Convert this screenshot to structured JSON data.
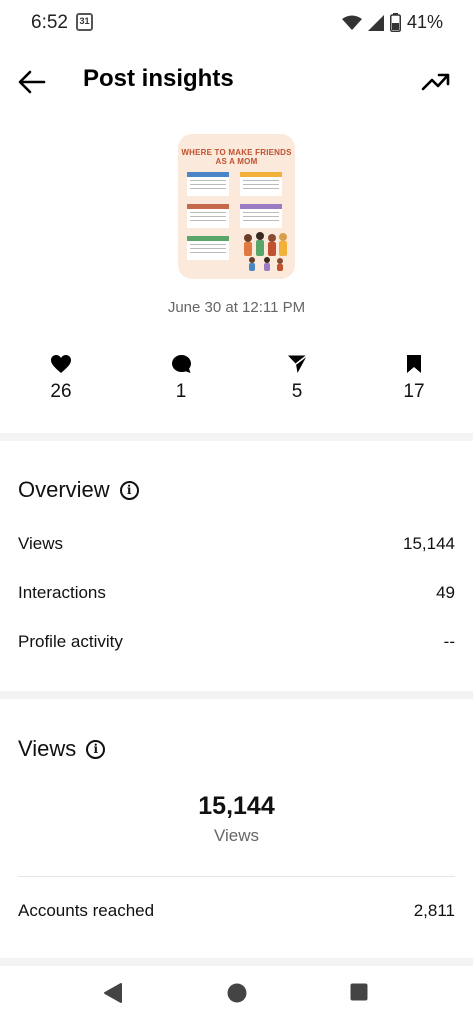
{
  "status_bar": {
    "time": "6:52",
    "calendar_day": "31",
    "battery": "41%"
  },
  "header": {
    "title": "Post insights",
    "back_icon": "arrow-left-icon",
    "trend_icon": "trending-up-icon"
  },
  "post": {
    "thumbnail_title": "WHERE TO MAKE FRIENDS AS A MOM",
    "date": "June 30 at 12:11 PM"
  },
  "stats": {
    "likes": "26",
    "comments": "1",
    "shares": "5",
    "saves": "17"
  },
  "overview": {
    "title": "Overview",
    "rows": [
      {
        "label": "Views",
        "value": "15,144"
      },
      {
        "label": "Interactions",
        "value": "49"
      },
      {
        "label": "Profile activity",
        "value": "--"
      }
    ]
  },
  "views": {
    "title": "Views",
    "total": "15,144",
    "caption": "Views",
    "accounts_label": "Accounts reached",
    "accounts_value": "2,811"
  },
  "colors": {
    "thumb_bg": "#fbe9dc",
    "thumb_title": "#c0522e",
    "card_blue": "#4a86c5",
    "card_yellow": "#f2b23a",
    "card_brown": "#c46a4a",
    "card_purple": "#9a7bc4",
    "card_green": "#5aa56a"
  }
}
